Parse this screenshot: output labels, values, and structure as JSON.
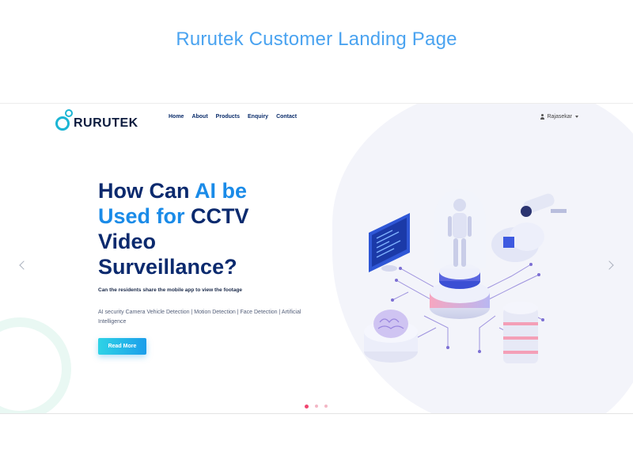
{
  "page_title": "Rurutek Customer Landing Page",
  "logo": {
    "text": "RURUTEK"
  },
  "nav": {
    "items": [
      {
        "label": "Home"
      },
      {
        "label": "About"
      },
      {
        "label": "Products"
      },
      {
        "label": "Enquiry"
      },
      {
        "label": "Contact"
      }
    ]
  },
  "user": {
    "name": "Rajasekar"
  },
  "hero": {
    "headline_part1": "How Can ",
    "headline_accent1": "AI be Used for",
    "headline_part2": " CCTV Video Surveillance?",
    "subheading": "Can the residents share the mobile app to view the footage",
    "description": "AI security Camera Vehicle Detection | Motion Detection | Face Detection | Artificial Intelligence",
    "button_label": "Read More"
  },
  "carousel": {
    "slides": 3,
    "active_index": 0
  },
  "colors": {
    "accent": "#1a8be8",
    "headline": "#0b2a6e",
    "title": "#4aa3f0",
    "dot_active": "#f0456f"
  },
  "icons": [
    "user-icon",
    "chevron-left-icon",
    "chevron-right-icon",
    "ai-robot-illustration",
    "cctv-camera-icon",
    "cloud-icon",
    "database-icon",
    "brain-icon",
    "monitor-icon"
  ]
}
